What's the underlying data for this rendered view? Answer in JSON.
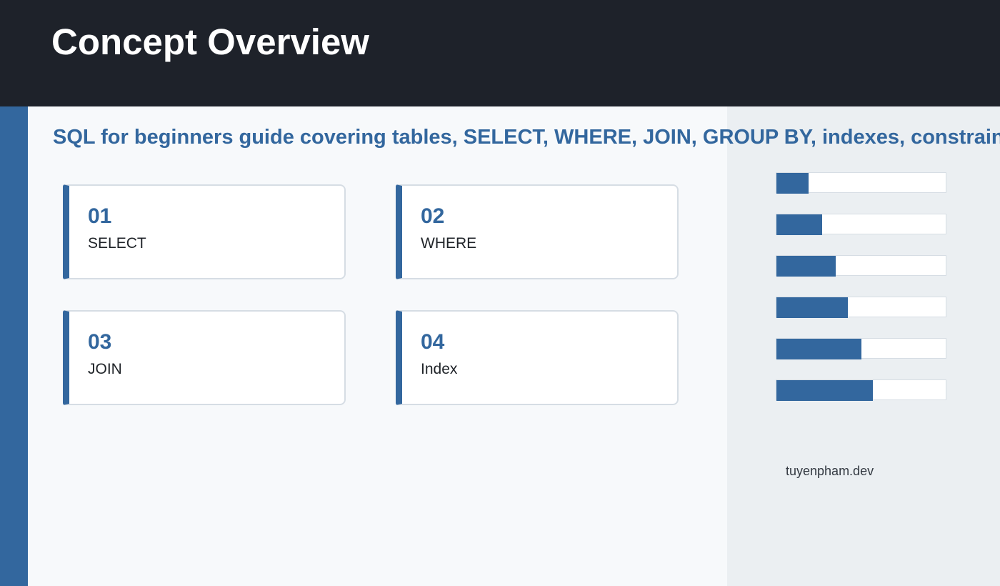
{
  "header": {
    "title": "Concept Overview"
  },
  "subtitle": "SQL for beginners guide covering tables, SELECT, WHERE, JOIN, GROUP BY, indexes, constraints",
  "cards": [
    {
      "number": "01",
      "label": "SELECT"
    },
    {
      "number": "02",
      "label": "WHERE"
    },
    {
      "number": "03",
      "label": "JOIN"
    },
    {
      "number": "04",
      "label": "Index"
    }
  ],
  "progress_bars": [
    0.19,
    0.27,
    0.35,
    0.42,
    0.5,
    0.57
  ],
  "footer": {
    "site": "tuyenpham.dev"
  },
  "colors": {
    "accent": "#33679e",
    "header_bg": "#1e222a",
    "panel_bg": "#ebeff2",
    "main_bg": "#f7f9fb"
  }
}
